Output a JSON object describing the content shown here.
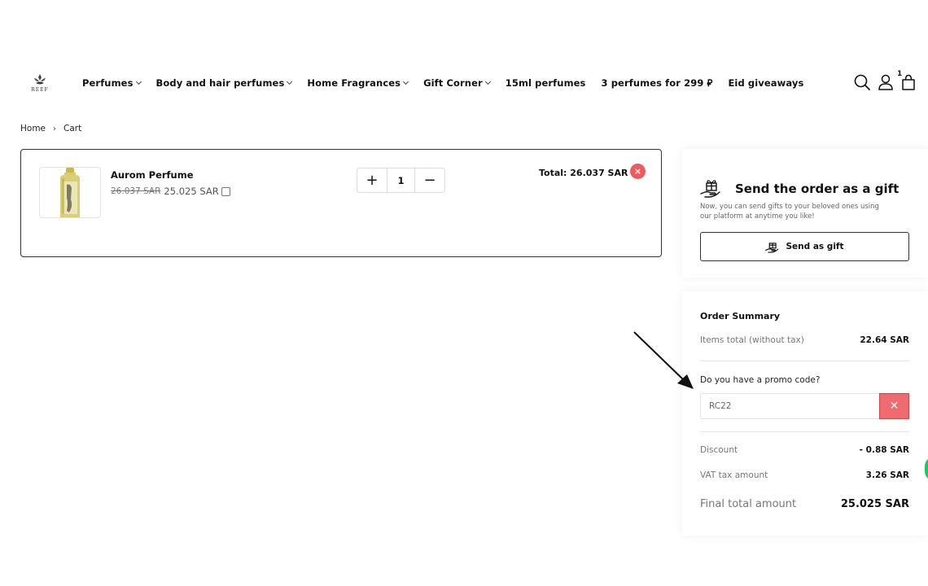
{
  "brand": {
    "logo_text": "REEF"
  },
  "nav": {
    "items": [
      {
        "label": "Perfumes",
        "has_dropdown": true
      },
      {
        "label": "Body and hair perfumes",
        "has_dropdown": true
      },
      {
        "label": "Home Fragrances",
        "has_dropdown": true
      },
      {
        "label": "Gift Corner",
        "has_dropdown": true
      },
      {
        "label": "15ml perfumes",
        "has_dropdown": false
      },
      {
        "label": "3 perfumes for 299 ⃁",
        "has_dropdown": false
      },
      {
        "label": "Eid giveaways",
        "has_dropdown": false
      }
    ]
  },
  "header_icons": {
    "cart_count": "1",
    "icons": [
      "search-icon",
      "account-icon",
      "cart-bag-icon"
    ]
  },
  "breadcrumb": {
    "home": "Home",
    "separator": "›",
    "current": "Cart"
  },
  "cart": {
    "items": [
      {
        "name": "Aurom Perfume",
        "old_price": "26.037 SAR",
        "price": "25.025 SAR",
        "quantity": "1",
        "plus": "+",
        "minus": "−",
        "total": "Total: 26.037 SAR",
        "remove": "×"
      }
    ]
  },
  "gift": {
    "title": "Send the order as a gift",
    "description": "Now, you can send gifts to your beloved ones using our platform at anytime you like!",
    "button": "Send as gift"
  },
  "summary": {
    "title": "Order Summary",
    "items_total_label": "Items total (without tax)",
    "items_total_value": "22.64 SAR",
    "promo_label": "Do you have a promo code?",
    "promo_value": "RC22",
    "promo_clear": "✕",
    "discount_label": "Discount",
    "discount_value": "- 0.88 SAR",
    "vat_label": "VAT tax amount",
    "vat_value": "3.26 SAR",
    "final_label": "Final total amount",
    "final_value": "25.025 SAR"
  },
  "colors": {
    "remove_red": "#ef5a5f",
    "promo_clear_red": "#ef6b70",
    "whatsapp_green": "#25c16a"
  }
}
